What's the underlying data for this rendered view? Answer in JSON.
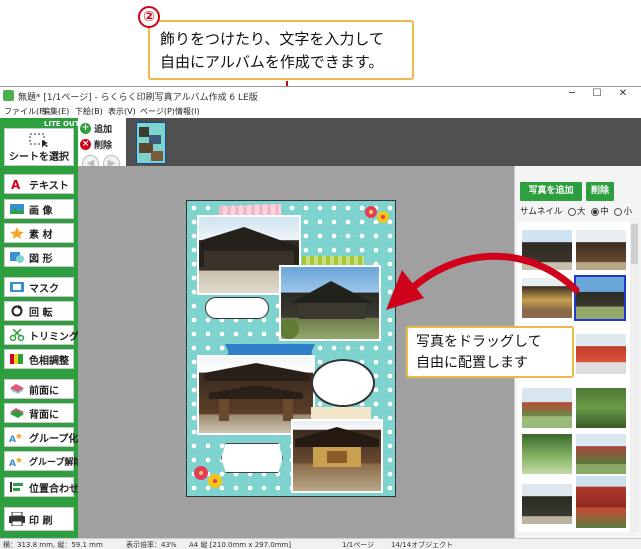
{
  "annotation": {
    "badge": "②",
    "callout_line1": "飾りをつけたり、文字を入力して",
    "callout_line2": "自由にアルバムを作成できます。",
    "drag_line1": "写真をドラッグして",
    "drag_line2": "自由に配置します"
  },
  "window": {
    "title": "無題* [1/1ページ] - らくらく印刷写真アルバム作成 6  LE版",
    "minimize": "─",
    "maximize": "☐",
    "close": "✕"
  },
  "menu": [
    "ファイル(F)",
    "編集(E)",
    "下絵(B)",
    "表示(V)",
    "ページ(P)",
    "情報(I)"
  ],
  "toolbar_left": {
    "badge": "LITE  OUT",
    "tools": [
      {
        "label": "シートを選択",
        "icon": "select-cursor-icon"
      },
      {
        "label": "テキスト",
        "icon": "text-a-icon"
      },
      {
        "label": "画 像",
        "icon": "image-icon"
      },
      {
        "label": "素 材",
        "icon": "star-icon"
      },
      {
        "label": "図 形",
        "icon": "shape-icon"
      },
      {
        "label": "マスク",
        "icon": "mask-icon"
      },
      {
        "label": "回 転",
        "icon": "rotate-icon"
      },
      {
        "label": "トリミング",
        "icon": "scissors-icon"
      },
      {
        "label": "色相調整",
        "icon": "color-adjust-icon"
      },
      {
        "label": "前面に",
        "icon": "bring-front-icon"
      },
      {
        "label": "背面に",
        "icon": "send-back-icon"
      },
      {
        "label": "グループ化",
        "icon": "group-icon"
      },
      {
        "label": "グループ解除",
        "icon": "ungroup-icon"
      },
      {
        "label": "位置合わせ",
        "icon": "align-icon"
      },
      {
        "label": "印 刷",
        "icon": "printer-icon"
      }
    ]
  },
  "page_strip": {
    "add": "追加",
    "delete": "削除"
  },
  "right_panel": {
    "add_photo": "写真を追加",
    "delete": "削除",
    "thumbnail_label": "サムネイル",
    "size_options": [
      "大",
      "中",
      "小"
    ],
    "selected_size": "中"
  },
  "status": {
    "coords": "横：313.8 mm, 縦：59.1 mm",
    "zoom": "表示倍率：43%",
    "paper": "A4 縦 [210.0mm x 297.0mm]",
    "page": "1/1ページ",
    "objects": "14/14オブジェクト"
  },
  "colors": {
    "accent_green": "#2e9f3e",
    "callout_border": "#f0b84a",
    "annotation_red": "#d0021b",
    "page_background": "#7fd3cf"
  }
}
